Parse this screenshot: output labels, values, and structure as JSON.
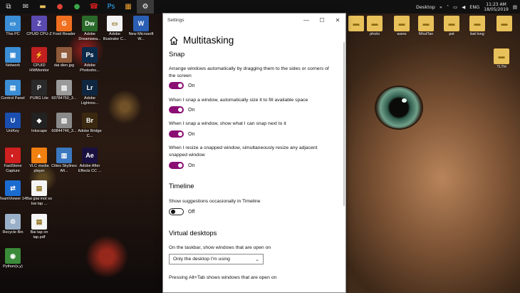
{
  "taskbar": {
    "buttons": [
      {
        "name": "task-view-icon",
        "glyph": "⧉",
        "color": "#dddddd"
      },
      {
        "name": "mail-icon",
        "glyph": "✉",
        "color": "#dddddd"
      },
      {
        "name": "folder-icon",
        "glyph": "▬",
        "color": "#e8c15b"
      },
      {
        "name": "chrome-icon",
        "glyph": "●",
        "color": "#e04437"
      },
      {
        "name": "coccoc-icon",
        "glyph": "●",
        "color": "#3aa64a"
      },
      {
        "name": "red-app-icon",
        "glyph": "☎",
        "color": "#e02020"
      },
      {
        "name": "photoshop-icon",
        "glyph": "Ps",
        "color": "#31a8ff"
      },
      {
        "name": "paint-icon",
        "glyph": "▦",
        "color": "#f0a030"
      },
      {
        "name": "settings-icon",
        "glyph": "⚙",
        "color": "#ffffff"
      }
    ],
    "tray": {
      "desktop_label": "Desktop",
      "language": "ENG",
      "time": "11:23 AM",
      "date": "18/05/2019"
    }
  },
  "desktop_icons_left": [
    {
      "label": "This PC",
      "glyph": "▭",
      "color": "#3b8ed6"
    },
    {
      "label": "CPUID CPU-Z",
      "glyph": "Z",
      "color": "#5a4ab0"
    },
    {
      "label": "Foxit Reader",
      "glyph": "G",
      "color": "#f07020"
    },
    {
      "label": "Adobe Dreamwea...",
      "glyph": "Dw",
      "color": "#2a6a2a"
    },
    {
      "label": "Adobe Illustrator C...",
      "glyph": "▭",
      "color": "#f3f3f3"
    },
    {
      "label": "New Microsoft W...",
      "glyph": "W",
      "color": "#2b5fb4"
    },
    {
      "label": "Network",
      "glyph": "▣",
      "color": "#3b8ed6"
    },
    {
      "label": "CPUID HWMonitor",
      "glyph": "⚡",
      "color": "#c02020"
    },
    {
      "label": "dai dien.jpg",
      "glyph": "▨",
      "color": "#8e5a3a"
    },
    {
      "label": "Adobe Photosho...",
      "glyph": "Ps",
      "color": "#0b2a4a"
    },
    {
      "label": "Control Panel",
      "glyph": "▤",
      "color": "#3b8ed6"
    },
    {
      "label": "PUBG Lite",
      "glyph": "P",
      "color": "#2a2a2a"
    },
    {
      "label": "60784750_3...",
      "glyph": "▨",
      "color": "#9a9a9a"
    },
    {
      "label": "Adobe Lightroo...",
      "glyph": "Lr",
      "color": "#0f2640"
    },
    {
      "label": "UniKey",
      "glyph": "U",
      "color": "#1a4fb0"
    },
    {
      "label": "Inkscape",
      "glyph": "◆",
      "color": "#222222"
    },
    {
      "label": "60844746_3...",
      "glyph": "▨",
      "color": "#8a8a8a"
    },
    {
      "label": "Adobe Bridge C...",
      "glyph": "Br",
      "color": "#3a2810"
    },
    {
      "label": "FastStone Capture",
      "glyph": "◐",
      "color": "#d02020"
    },
    {
      "label": "VLC media player",
      "glyph": "▲",
      "color": "#f08010"
    },
    {
      "label": "Cities Skylines Aft...",
      "glyph": "▥",
      "color": "#3a78c0"
    },
    {
      "label": "Adobe After Effects CC ...",
      "glyph": "Ae",
      "color": "#1a1040"
    },
    {
      "label": "TeamViewer 14",
      "glyph": "⇄",
      "color": "#1a6cd0"
    },
    {
      "label": "Bai giai mot so bai tap ...",
      "glyph": "▤",
      "color": "#f5f5f5"
    },
    {
      "label": "Recycle Bin",
      "glyph": "♲",
      "color": "#9ab0c8"
    },
    {
      "label": "Bai tap on tap.pdf",
      "glyph": "▤",
      "color": "#f5f5f5"
    },
    {
      "label": "Python(x,y)",
      "glyph": "◉",
      "color": "#3a8a3a"
    }
  ],
  "desktop_icons_right": [
    {
      "label": "",
      "glyph": "▬",
      "color": "#e8c15b"
    },
    {
      "label": "photo",
      "glyph": "▬",
      "color": "#e8c15b"
    },
    {
      "label": "wano",
      "glyph": "▬",
      "color": "#e8c15b"
    },
    {
      "label": "NhutTan",
      "glyph": "▬",
      "color": "#e8c15b"
    },
    {
      "label": "pst",
      "glyph": "▬",
      "color": "#e8c15b"
    },
    {
      "label": "bat long",
      "glyph": "▬",
      "color": "#e8c15b"
    },
    {
      "label": "",
      "glyph": "▬",
      "color": "#e8c15b"
    },
    {
      "label": "TLTH",
      "glyph": "▬",
      "color": "#e8c15b"
    }
  ],
  "settings": {
    "window_title": "Settings",
    "page_title": "Multitasking",
    "snap": {
      "heading": "Snap",
      "items": [
        {
          "desc": "Arrange windows automatically by dragging them to the sides or corners of the screen",
          "state": "On"
        },
        {
          "desc": "When I snap a window, automatically size it to fill available space",
          "state": "On"
        },
        {
          "desc": "When I snap a window, show what I can snap next to it",
          "state": "On"
        },
        {
          "desc": "When I resize a snapped window, simultaneously resize any adjacent snapped window",
          "state": "On"
        }
      ]
    },
    "timeline": {
      "heading": "Timeline",
      "desc": "Show suggestions occasionally in Timeline",
      "state": "Off"
    },
    "virtual_desktops": {
      "heading": "Virtual desktops",
      "taskbar_desc": "On the taskbar, show windows that are open on",
      "taskbar_value": "Only the desktop I'm using",
      "alttab_desc": "Pressing Alt+Tab shows windows that are open on"
    },
    "colors": {
      "accent": "#8a0e73"
    }
  }
}
